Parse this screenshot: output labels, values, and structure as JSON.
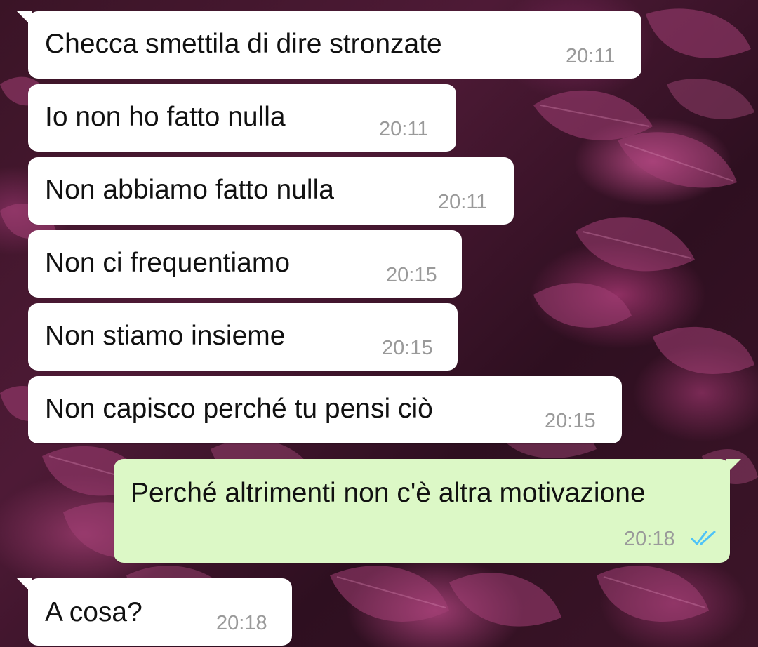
{
  "conversation": {
    "messages": [
      {
        "direction": "incoming",
        "text": "Checca smettila di dire stronzate",
        "time": "20:11"
      },
      {
        "direction": "incoming",
        "text": "Io non ho fatto nulla",
        "time": "20:11"
      },
      {
        "direction": "incoming",
        "text": "Non abbiamo fatto nulla",
        "time": "20:11"
      },
      {
        "direction": "incoming",
        "text": "Non ci frequentiamo",
        "time": "20:15"
      },
      {
        "direction": "incoming",
        "text": "Non stiamo insieme",
        "time": "20:15"
      },
      {
        "direction": "incoming",
        "text": "Non capisco perché tu pensi ciò",
        "time": "20:15"
      },
      {
        "direction": "outgoing",
        "text": "Perché altrimenti non c'è altra motivazione",
        "time": "20:18",
        "status": "read"
      },
      {
        "direction": "incoming",
        "text": "A cosa?",
        "time": "20:18"
      }
    ]
  },
  "colors": {
    "incoming_bubble": "#ffffff",
    "outgoing_bubble": "#dcf8c6",
    "read_ticks": "#4fc3f7",
    "timestamp": "#9a9a9a",
    "wallpaper": "#4e1a36"
  },
  "icons": {
    "read_status": "double-check-icon"
  }
}
